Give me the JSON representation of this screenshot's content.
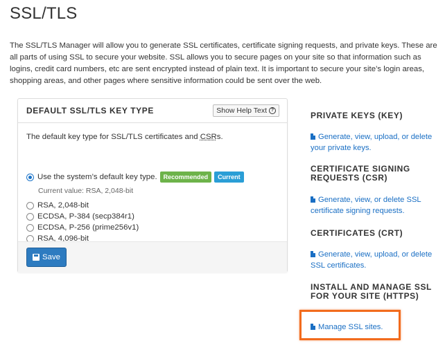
{
  "page": {
    "title": "SSL/TLS",
    "intro": "The SSL/TLS Manager will allow you to generate SSL certificates, certificate signing requests, and private keys. These are all parts of using SSL to secure your website. SSL allows you to secure pages on your site so that information such as logins, credit card numbers, etc are sent encrypted instead of plain text. It is important to secure your site’s login areas, shopping areas, and other pages where sensitive information could be sent over the web."
  },
  "key_panel": {
    "title": "DEFAULT SSL/TLS KEY TYPE",
    "help_button": "Show Help Text",
    "description_prefix": "The default key type for SSL/TLS certificates and ",
    "description_abbr": "CSR",
    "description_suffix": "s.",
    "options": [
      {
        "label": "Use the system’s default key type.",
        "checked": true
      },
      {
        "label": "RSA, 2,048-bit",
        "checked": false
      },
      {
        "label": "ECDSA, P-384 (secp384r1)",
        "checked": false
      },
      {
        "label": "ECDSA, P-256 (prime256v1)",
        "checked": false
      },
      {
        "label": "RSA, 4,096-bit",
        "checked": false
      }
    ],
    "badge_recommended": "Recommended",
    "badge_current": "Current",
    "current_value": "Current value: RSA, 2,048-bit",
    "save_label": "Save"
  },
  "sidebar": {
    "sections": [
      {
        "heading": "PRIVATE KEYS (KEY)",
        "link": "Generate, view, upload, or delete your private keys."
      },
      {
        "heading": "CERTIFICATE SIGNING REQUESTS (CSR)",
        "link": "Generate, view, or delete SSL certificate signing requests."
      },
      {
        "heading": "CERTIFICATES (CRT)",
        "link": "Generate, view, upload, or delete SSL certificates."
      },
      {
        "heading": "INSTALL AND MANAGE SSL FOR YOUR SITE (HTTPS)",
        "link": "Manage SSL sites."
      }
    ]
  },
  "colors": {
    "link": "#1a6fc4",
    "primary_button": "#2d7bc0",
    "badge_recommended": "#6db34a",
    "badge_current": "#2a9ed6",
    "highlight": "#f26b1d"
  }
}
